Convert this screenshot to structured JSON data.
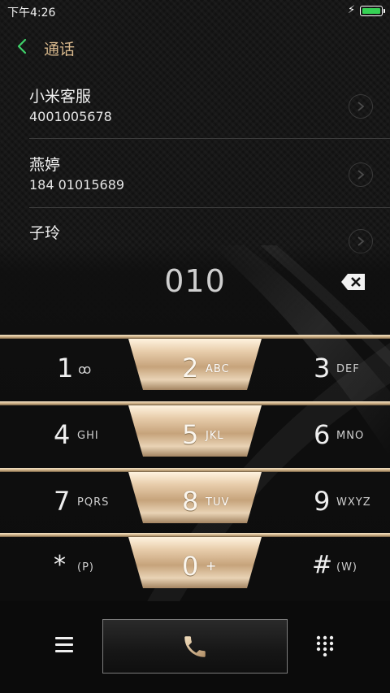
{
  "status_bar": {
    "time": "下午4:26"
  },
  "header": {
    "title": "通话"
  },
  "contacts": [
    {
      "name": "小米客服",
      "number": "4001005678"
    },
    {
      "name": "燕婷",
      "number": "184 01015689"
    },
    {
      "name": "子玲",
      "number": ""
    }
  ],
  "dialer": {
    "display": "010",
    "rows": [
      [
        {
          "digit": "1",
          "letters": "ꝏ"
        },
        {
          "digit": "2",
          "letters": "ABC"
        },
        {
          "digit": "3",
          "letters": "DEF"
        }
      ],
      [
        {
          "digit": "4",
          "letters": "GHI"
        },
        {
          "digit": "5",
          "letters": "JKL"
        },
        {
          "digit": "6",
          "letters": "MNO"
        }
      ],
      [
        {
          "digit": "7",
          "letters": "PQRS"
        },
        {
          "digit": "8",
          "letters": "TUV"
        },
        {
          "digit": "9",
          "letters": "WXYZ"
        }
      ],
      [
        {
          "digit": "*",
          "letters": "(P)"
        },
        {
          "digit": "0",
          "letters": "+"
        },
        {
          "digit": "#",
          "letters": "(W)"
        }
      ]
    ]
  },
  "colors": {
    "accent_gold": "#d9b98d",
    "back_arrow": "#3fd26a",
    "battery": "#35d154"
  },
  "icons": {
    "back": "chevron-left-icon",
    "contact_detail": "chevron-right-circle-icon",
    "backspace": "backspace-icon",
    "menu": "hamburger-menu-icon",
    "call": "phone-handset-icon",
    "keypad_toggle": "dialpad-grid-icon"
  }
}
